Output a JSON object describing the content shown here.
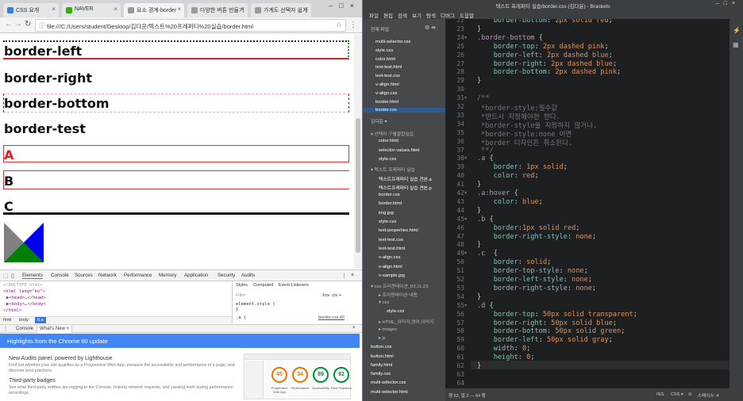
{
  "browser": {
    "tabs": [
      {
        "label": "CSS 요개",
        "favicon_color": "#3c7bd6"
      },
      {
        "label": "NAVER",
        "favicon_color": "#2db400"
      },
      {
        "label": "요소 경계-border",
        "favicon_color": "#999999"
      },
      {
        "label": "다양한 버튼 만들기",
        "favicon_color": "#999999"
      },
      {
        "label": "가계도 선택자 쉽게",
        "favicon_color": "#999999"
      }
    ],
    "url": "file:///C:/Users/student/Desktop/김다윤/텍스트%20프레퍼티%20실습/border.html",
    "page": {
      "items": [
        "border-left",
        "border-right",
        "border-bottom",
        "border-test",
        "A",
        "B",
        "C"
      ]
    },
    "devtools": {
      "tabs": [
        "Elements",
        "Console",
        "Sources",
        "Network",
        "Performance",
        "Memory",
        "Application",
        "Security",
        "Audits"
      ],
      "elements_lines": [
        "<!DOCTYPE html>",
        "<html lang=\"ko\">",
        "▶<head>…</head>",
        "▶<body>…</body>",
        "</html>"
      ],
      "breadcrumb": [
        "html",
        "body",
        "b.a"
      ],
      "styles_tabs": [
        "Styles",
        "Computed",
        "Event Listeners"
      ],
      "filter_placeholder": "Filter",
      "hov_cls": ":hov  .cls  +",
      "element_style": "element.style {",
      "element_style_close": "}",
      "rule_selector": ".a {",
      "rule_source": "border.css:40",
      "drawer_tabs": [
        "Console",
        "What's New ×"
      ],
      "whatsnew_title": "Highlights from the Chrome 60 update",
      "items": [
        {
          "title": "New Audits panel, powered by Lighthouse",
          "desc": "Find out whether your site qualifies as a Progressive Web App, measure the accessibility and performance of a page, and discover best practices."
        },
        {
          "title": "Third-party badges",
          "desc": "See what third-party entities are logging to the Console, making network requests, and causing work during performance recordings."
        }
      ],
      "lighthouse": {
        "scores": [
          "45",
          "34",
          "89",
          "92"
        ],
        "labels": [
          "Progressive Web App",
          "Performance",
          "Accessibility",
          "Best Practices"
        ],
        "colors": [
          "#e67700",
          "#e67700",
          "#0a8a38",
          "#0a8a38"
        ]
      }
    }
  },
  "brackets": {
    "title": "텍스트 프레퍼티 실습/border.css (김다윤) - Brackets",
    "menu": [
      "파일",
      "편집",
      "검색",
      "보기",
      "탐색",
      "디버그",
      "도움말"
    ],
    "sidebar": {
      "working_files_label": "현재 파일",
      "working_files": [
        "multi-selector.css",
        "style.css",
        "color.html",
        "text-test.html",
        "text-test.css",
        "v-align.html",
        "v-align.css",
        "border.html",
        "border.css"
      ],
      "project_label": "김다윤 ▾",
      "tree": [
        {
          "label": "▾ 선택자 구별결합실습",
          "indent": 0,
          "dim": true
        },
        {
          "label": "color.html",
          "indent": 1
        },
        {
          "label": "selector-values.html",
          "indent": 1
        },
        {
          "label": "style.css",
          "indent": 1
        },
        {
          "label": "▾ 텍스트 프레퍼티 실습",
          "indent": 0,
          "dim": true
        },
        {
          "label": "텍스트프레퍼티 실습 견본.a",
          "indent": 1
        },
        {
          "label": "텍스트프레퍼티 실습 견본.p",
          "indent": 1
        },
        {
          "label": "border.css",
          "indent": 1
        },
        {
          "label": "border.html",
          "indent": 1
        },
        {
          "label": "img.jpg",
          "indent": 1
        },
        {
          "label": "style.css",
          "indent": 1
        },
        {
          "label": "text-properties.html",
          "indent": 1
        },
        {
          "label": "text-test.css",
          "indent": 1
        },
        {
          "label": "text-test.html",
          "indent": 1
        },
        {
          "label": "v-align.css",
          "indent": 1
        },
        {
          "label": "v-align.html",
          "indent": 1
        },
        {
          "label": "v-sample.jpg",
          "indent": 1
        },
        {
          "label": "▾ css 프리젠테이션_03.11.23",
          "indent": 0,
          "dim": true
        },
        {
          "label": "▸ 프리젠테이션 내용",
          "indent": 1,
          "dim": true
        },
        {
          "label": "▾ css",
          "indent": 1,
          "dim": true
        },
        {
          "label": "style.css",
          "indent": 2
        },
        {
          "label": "▸ HTML_이미지,영어,이미지",
          "indent": 1,
          "dim": true
        },
        {
          "label": "▸ images",
          "indent": 1,
          "dim": true
        },
        {
          "label": "▸ js",
          "indent": 1,
          "dim": true
        },
        {
          "label": "button.css",
          "indent": 0
        },
        {
          "label": "button.html",
          "indent": 0
        },
        {
          "label": "family.html",
          "indent": 0
        },
        {
          "label": "family.css",
          "indent": 0
        },
        {
          "label": "multi-selector.css",
          "indent": 0
        },
        {
          "label": "multi-selector.html",
          "indent": 0
        }
      ]
    },
    "code": [
      {
        "n": "22",
        "html": "    <span class=\"prop\">border-bottom</span><span class=\"pun\">:</span> <span class=\"num\">2px</span> <span class=\"val\">solid</span> <span class=\"val\">red</span><span class=\"pun\">;</span>"
      },
      {
        "n": "23",
        "html": "<span class=\"brace\">}</span>"
      },
      {
        "n": "24",
        "fold": "▾",
        "html": "<span class=\"sel\">.border-bottom</span> <span class=\"brace\">{</span>"
      },
      {
        "n": "25",
        "html": "    <span class=\"prop\">border-top</span><span class=\"pun\">:</span> <span class=\"num\">2px</span> <span class=\"val\">dashed</span> <span class=\"val\">pink</span><span class=\"pun\">;</span>"
      },
      {
        "n": "26",
        "html": "    <span class=\"prop\">border-left</span><span class=\"pun\">:</span> <span class=\"num\">2px</span> <span class=\"val\">dashed</span> <span class=\"val\">blue</span><span class=\"pun\">;</span>"
      },
      {
        "n": "27",
        "html": "    <span class=\"prop\">border-right</span><span class=\"pun\">:</span> <span class=\"num\">2px</span> <span class=\"val\">dashed</span> <span class=\"val\">blue</span><span class=\"pun\">;</span>"
      },
      {
        "n": "28",
        "html": "    <span class=\"prop\">border-bottom</span><span class=\"pun\">:</span> <span class=\"num\">2px</span> <span class=\"val\">dashed</span> <span class=\"val\">pink</span><span class=\"pun\">;</span>"
      },
      {
        "n": "29",
        "html": "<span class=\"brace\">}</span>"
      },
      {
        "n": "30",
        "html": ""
      },
      {
        "n": "31",
        "fold": "▾",
        "html": "<span class=\"com\">/**</span>"
      },
      {
        "n": "32",
        "html": "<span class=\"com\"> *border-style:필수값</span>"
      },
      {
        "n": "33",
        "html": "<span class=\"com\"> *반드시 지정해야한 한다.</span>"
      },
      {
        "n": "34",
        "html": "<span class=\"com\"> *border-style을 지정하지 않거나,</span>"
      },
      {
        "n": "35",
        "html": "<span class=\"com\"> *border-style:none 이면</span>"
      },
      {
        "n": "36",
        "html": "<span class=\"com\"> *border 디자인은 취소된다.</span>"
      },
      {
        "n": "37",
        "html": "<span class=\"com\"> **/</span>"
      },
      {
        "n": "38",
        "fold": "▾",
        "html": "<span class=\"sel\">.a</span> <span class=\"brace\">{</span>"
      },
      {
        "n": "39",
        "html": "    <span class=\"prop\">border</span><span class=\"pun\">:</span> <span class=\"num\">1px</span> <span class=\"val\">solid</span><span class=\"pun\">;</span>"
      },
      {
        "n": "40",
        "html": "    <span class=\"prop\">color</span><span class=\"pun\">:</span> <span class=\"val\">red</span><span class=\"pun\">;</span>"
      },
      {
        "n": "41",
        "html": "<span class=\"brace\">}</span>"
      },
      {
        "n": "42",
        "fold": "▾",
        "html": "<span class=\"sel\">.a:hover</span> <span class=\"brace\">{</span>"
      },
      {
        "n": "43",
        "html": "    <span class=\"prop\">color</span><span class=\"pun\">:</span> <span class=\"val\">blue</span><span class=\"pun\">;</span>"
      },
      {
        "n": "44",
        "html": "<span class=\"brace\">}</span>"
      },
      {
        "n": "45",
        "fold": "▾",
        "html": "<span class=\"sel\">.b</span> <span class=\"brace\">{</span>"
      },
      {
        "n": "46",
        "html": "    <span class=\"prop\">border</span><span class=\"pun\">:</span><span class=\"num\">1px</span> <span class=\"val\">solid</span> <span class=\"val\">red</span><span class=\"pun\">;</span>"
      },
      {
        "n": "47",
        "html": "    <span class=\"prop\">border-right-style</span><span class=\"pun\">:</span> <span class=\"val\">none</span><span class=\"pun\">;</span>"
      },
      {
        "n": "48",
        "html": "<span class=\"brace\">}</span>"
      },
      {
        "n": "49",
        "fold": "▾",
        "html": "<span class=\"sel\">.c</span>  <span class=\"brace\">{</span>"
      },
      {
        "n": "50",
        "html": "    <span class=\"prop\">border</span><span class=\"pun\">:</span> <span class=\"val\">solid</span><span class=\"pun\">;</span>"
      },
      {
        "n": "51",
        "html": "    <span class=\"prop\">border-top-style</span><span class=\"pun\">:</span> <span class=\"val\">none</span><span class=\"pun\">;</span>"
      },
      {
        "n": "52",
        "html": "    <span class=\"prop\">border-left-style</span><span class=\"pun\">:</span> <span class=\"val\">none</span><span class=\"pun\">;</span>"
      },
      {
        "n": "53",
        "html": "    <span class=\"prop\">border-right-style</span><span class=\"pun\">:</span> <span class=\"val\">none</span><span class=\"pun\">;</span>"
      },
      {
        "n": "54",
        "html": "<span class=\"brace\">}</span>"
      },
      {
        "n": "55",
        "fold": "▾",
        "html": "<span class=\"sel\">.d</span> <span class=\"brace\">{</span>"
      },
      {
        "n": "56",
        "html": "    <span class=\"prop\">border-top</span><span class=\"pun\">:</span> <span class=\"num\">50px</span> <span class=\"val\">solid</span> <span class=\"val\">transparent</span><span class=\"pun\">;</span>"
      },
      {
        "n": "57",
        "html": "    <span class=\"prop\">border-right</span><span class=\"pun\">:</span> <span class=\"num\">50px</span> <span class=\"val\">solid</span> <span class=\"val\">blue</span><span class=\"pun\">;</span>"
      },
      {
        "n": "58",
        "html": "    <span class=\"prop\">border-bottom</span><span class=\"pun\">:</span> <span class=\"num\">50px</span> <span class=\"val\">solid</span> <span class=\"val\">green</span><span class=\"pun\">;</span>"
      },
      {
        "n": "59",
        "html": "    <span class=\"prop\">border-left</span><span class=\"pun\">:</span> <span class=\"num\">50px</span> <span class=\"val\">solid</span> <span class=\"val\">gray</span><span class=\"pun\">;</span>"
      },
      {
        "n": "60",
        "html": "    <span class=\"prop\">width</span><span class=\"pun\">:</span> <span class=\"num\">0</span><span class=\"pun\">;</span>"
      },
      {
        "n": "61",
        "html": "    <span class=\"prop\">height</span><span class=\"pun\">:</span> <span class=\"num\">0</span><span class=\"pun\">;</span>"
      },
      {
        "n": "62",
        "html": "<span class=\"brace\">}</span>"
      },
      {
        "n": "63",
        "html": ""
      },
      {
        "n": "64",
        "html": ""
      }
    ],
    "status": {
      "position": "행 62, 열 2 — 64 행",
      "ins": "INS",
      "lang": "CSS ▾",
      "spaces": "스페이스: 4"
    }
  }
}
